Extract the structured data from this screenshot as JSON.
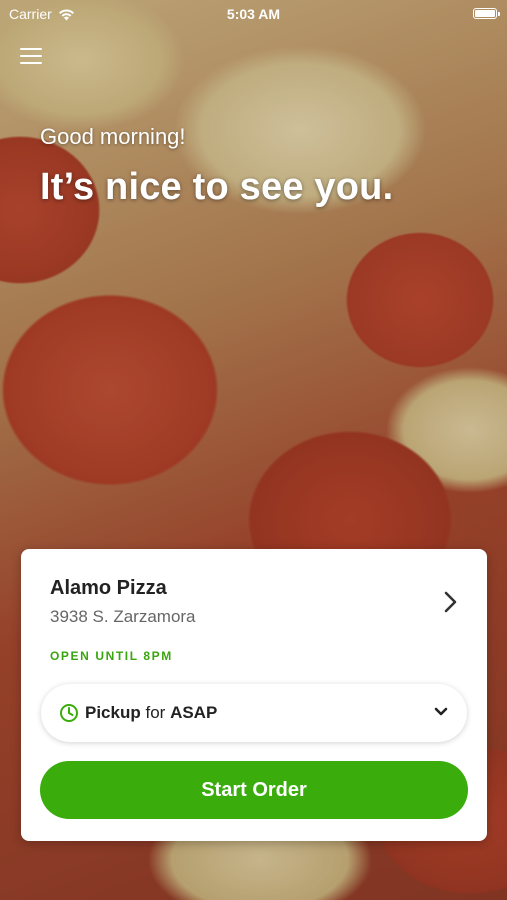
{
  "status_bar": {
    "carrier": "Carrier",
    "time": "5:03 AM"
  },
  "greeting": "Good morning!",
  "headline": "It’s nice to see you.",
  "store": {
    "name": "Alamo Pizza",
    "address": "3938 S. Zarzamora",
    "open_status": "OPEN UNTIL 8PM"
  },
  "order_mode": {
    "method": "Pickup",
    "connector": "for",
    "time": "ASAP"
  },
  "start_button_label": "Start Order",
  "colors": {
    "accent_green": "#3aad0c",
    "open_status_green": "#3aa50f"
  },
  "icons": [
    "wifi-icon",
    "battery-icon",
    "menu-icon",
    "chevron-right-icon",
    "clock-icon",
    "chevron-down-icon"
  ]
}
